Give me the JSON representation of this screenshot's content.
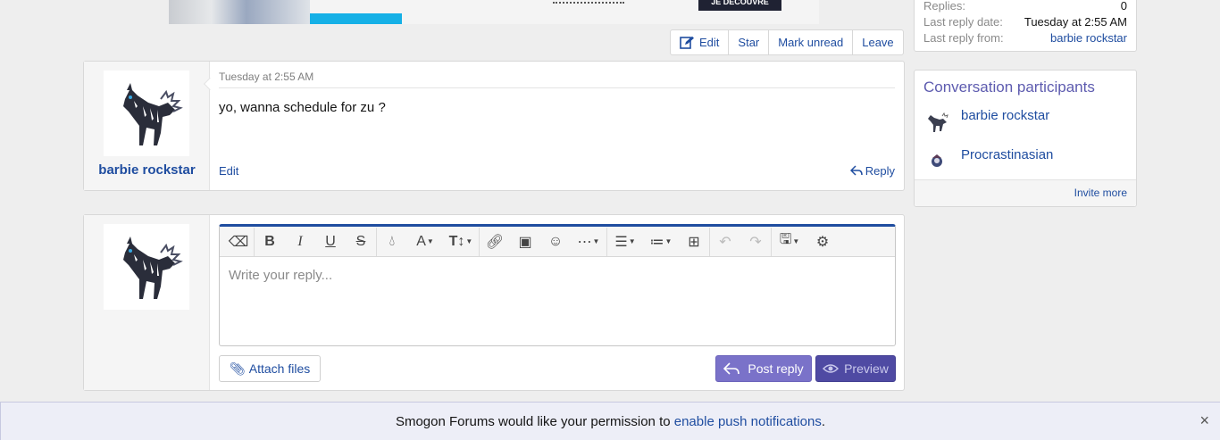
{
  "actions": {
    "edit": "Edit",
    "star": "Star",
    "mark_unread": "Mark unread",
    "leave": "Leave"
  },
  "info": {
    "replies_label": "Replies:",
    "replies_value": "0",
    "last_reply_date_label": "Last reply date:",
    "last_reply_date_value": "Tuesday at 2:55 AM",
    "last_reply_from_label": "Last reply from:",
    "last_reply_from_value": "barbie rockstar"
  },
  "participants": {
    "title": "Conversation participants",
    "items": [
      {
        "name": "barbie rockstar"
      },
      {
        "name": "Procrastinasian"
      }
    ],
    "invite": "Invite more"
  },
  "message": {
    "username": "barbie rockstar",
    "date": "Tuesday at 2:55 AM",
    "content": "yo, wanna schedule for zu ?",
    "edit": "Edit",
    "reply": "Reply"
  },
  "editor": {
    "placeholder": "Write your reply...",
    "attach": "Attach files",
    "post": "Post reply",
    "preview": "Preview"
  },
  "notice": {
    "before": "Smogon Forums would like your permission to ",
    "link": "enable push notifications",
    "after": ".",
    "close": "×"
  },
  "ad": {
    "button": "JE DÉCOUVRE"
  }
}
